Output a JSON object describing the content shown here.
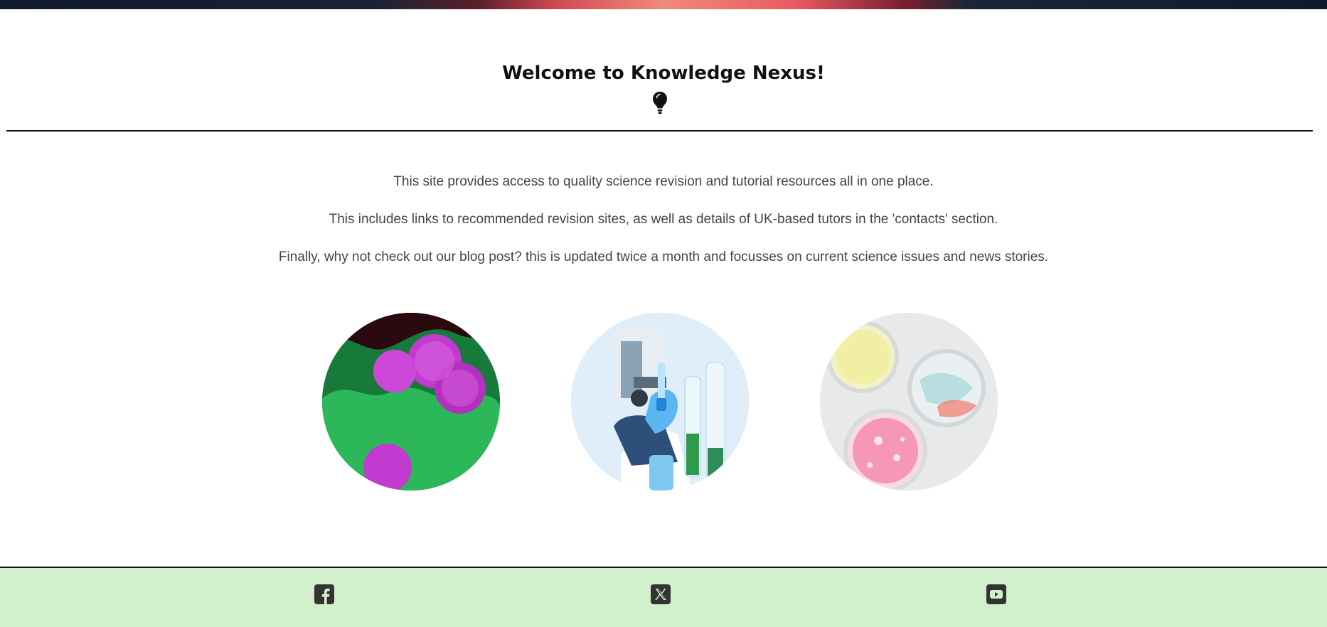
{
  "hero": {
    "accent_colors": [
      "#0f1a2c",
      "#d24a55",
      "#f08a7a",
      "#0e1a2c"
    ]
  },
  "welcome": {
    "title": "Welcome to Knowledge Nexus!",
    "icon": "lightbulb-icon"
  },
  "intro": {
    "lines": [
      "This site provides access to quality science revision and tutorial resources all in one place.",
      "This includes links to recommended revision sites, as well as details of UK-based tutors in the 'contacts' section.",
      "Finally, why not check out our blog post? this is updated twice a month and focusses on current science issues and news stories."
    ]
  },
  "gallery": {
    "images": [
      {
        "name": "bacteria-micrograph-image"
      },
      {
        "name": "lab-scientist-microscope-image"
      },
      {
        "name": "petri-dishes-image"
      }
    ]
  },
  "footer": {
    "background": "#d3f0cd",
    "social": [
      {
        "name": "facebook-icon"
      },
      {
        "name": "x-twitter-icon"
      },
      {
        "name": "youtube-icon"
      }
    ]
  }
}
